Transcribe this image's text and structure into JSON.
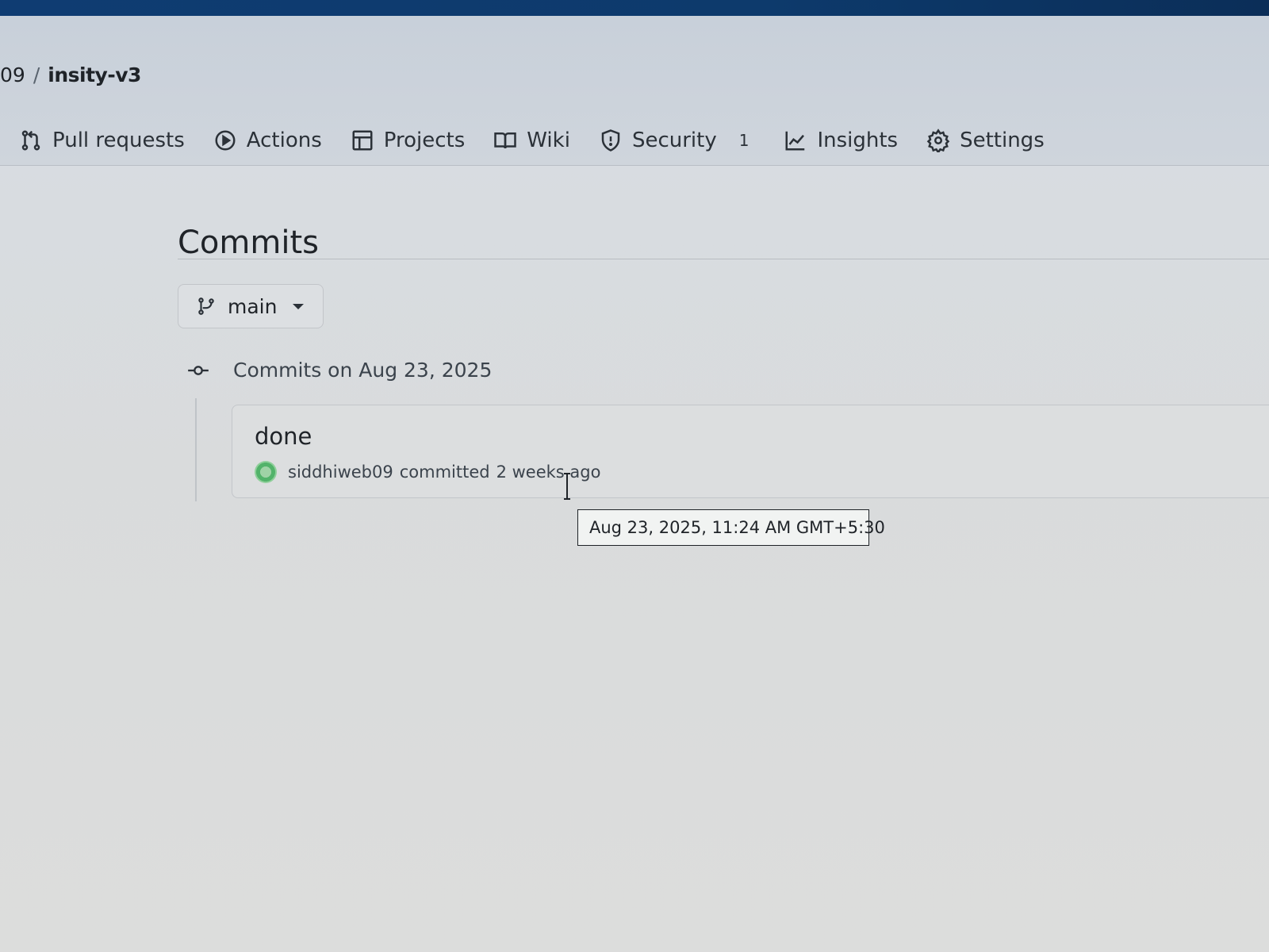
{
  "breadcrumb": {
    "owner_fragment": "09",
    "separator": "/",
    "repo": "insity-v3"
  },
  "nav": {
    "tabs": [
      {
        "label": "Pull requests",
        "icon": "git-pull-request-icon"
      },
      {
        "label": "Actions",
        "icon": "play-circle-icon"
      },
      {
        "label": "Projects",
        "icon": "table-icon"
      },
      {
        "label": "Wiki",
        "icon": "book-icon"
      },
      {
        "label": "Security",
        "icon": "shield-icon",
        "counter": "1"
      },
      {
        "label": "Insights",
        "icon": "graph-icon"
      },
      {
        "label": "Settings",
        "icon": "gear-icon"
      }
    ]
  },
  "page": {
    "title": "Commits"
  },
  "branch": {
    "name": "main"
  },
  "commit_group": {
    "heading": "Commits on Aug 23, 2025",
    "commits": [
      {
        "message": "done",
        "author": "siddhiweb09",
        "action": "committed",
        "relative_time": "2 weeks ago"
      }
    ]
  },
  "tooltip": {
    "text": "Aug 23, 2025, 11:24 AM GMT+5:30"
  }
}
